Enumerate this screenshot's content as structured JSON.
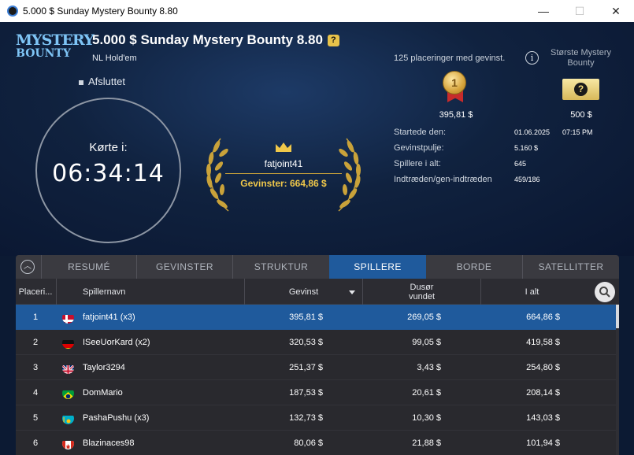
{
  "window": {
    "title": "5.000 $ Sunday Mystery Bounty 8.80",
    "minimize": "—",
    "maximize": "☐",
    "close": "✕"
  },
  "logo": {
    "line1": "MYSTERY",
    "line2": "BOUNTY"
  },
  "tournament": {
    "title": "5.000 $ Sunday Mystery Bounty 8.80",
    "help_badge": "?",
    "game": "NL Hold'em",
    "status": "Afsluttet"
  },
  "clock": {
    "label": "Kørte i:",
    "time": "06:34:14"
  },
  "winner": {
    "name": "fatjoint41",
    "prize_label": "Gevinster: 664,86 $"
  },
  "summary": {
    "places_paid": "125 placeringer med gevinst.",
    "info_icon": "i",
    "biggest_label": "Største Mystery Bounty",
    "first_medal": "1",
    "first_amount": "395,81 $",
    "ticket_symbol": "?",
    "biggest_amount": "500 $"
  },
  "stats": {
    "started_label": "Startede den:",
    "started_date": "01.06.2025",
    "started_time": "07:15 PM",
    "pool_label": "Gevinstpulje:",
    "pool_value": "5.160 $",
    "players_label": "Spillere i alt:",
    "players_value": "645",
    "entries_label": "Indtræden/gen-indtræden",
    "entries_value": "459/186"
  },
  "tabs": [
    {
      "label": "RESUMÉ"
    },
    {
      "label": "GEVINSTER"
    },
    {
      "label": "STRUKTUR"
    },
    {
      "label": "SPILLERE"
    },
    {
      "label": "BORDE"
    },
    {
      "label": "SATELLITTER"
    }
  ],
  "active_tab": "SPILLERE",
  "columns": {
    "rank": "Placeri...",
    "name": "Spillernavn",
    "prize": "Gevinst",
    "bounty": "Dusør vundet",
    "total": "I alt"
  },
  "players": [
    {
      "rank": "1",
      "flag": "denmark-flag-icon",
      "name": "fatjoint41 (x3)",
      "prize": "395,81 $",
      "bounty": "269,05 $",
      "total": "664,86 $"
    },
    {
      "rank": "2",
      "flag": "germany-flag-icon",
      "name": "ISeeUorKard (x2)",
      "prize": "320,53 $",
      "bounty": "99,05 $",
      "total": "419,58 $"
    },
    {
      "rank": "3",
      "flag": "uk-flag-icon",
      "name": "Taylor3294",
      "prize": "251,37 $",
      "bounty": "3,43 $",
      "total": "254,80 $"
    },
    {
      "rank": "4",
      "flag": "brazil-flag-icon",
      "name": "DomMario",
      "prize": "187,53 $",
      "bounty": "20,61 $",
      "total": "208,14 $"
    },
    {
      "rank": "5",
      "flag": "kazakhstan-flag-icon",
      "name": "PashaPushu (x3)",
      "prize": "132,73 $",
      "bounty": "10,30 $",
      "total": "143,03 $"
    },
    {
      "rank": "6",
      "flag": "canada-flag-icon",
      "name": "Blazinaces98",
      "prize": "80,06 $",
      "bounty": "21,88 $",
      "total": "101,94 $"
    }
  ],
  "colors": {
    "accent": "#1f5a9c",
    "gold": "#f0c84a",
    "background": "#0c1a33",
    "panel": "#29292e"
  }
}
